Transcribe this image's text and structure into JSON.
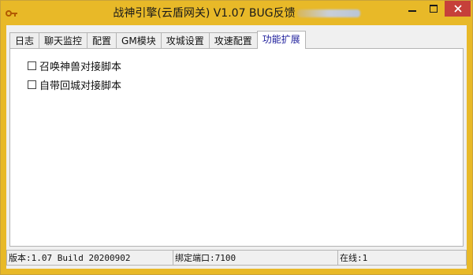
{
  "window": {
    "title": "战神引擎(云盾网关) V1.07 BUG反馈",
    "icon": "key-icon",
    "controls": {
      "minimize": "minimize-icon",
      "maximize": "maximize-icon",
      "close": "close-icon"
    }
  },
  "tabs": [
    {
      "label": "日志"
    },
    {
      "label": "聊天监控"
    },
    {
      "label": "配置"
    },
    {
      "label": "GM模块"
    },
    {
      "label": "攻城设置"
    },
    {
      "label": "攻速配置"
    },
    {
      "label": "功能扩展",
      "active": true
    }
  ],
  "options": [
    {
      "label": "召唤神兽对接脚本",
      "checked": false
    },
    {
      "label": "自带回城对接脚本",
      "checked": false
    }
  ],
  "status": {
    "version": "版本:1.07 Build 20200902",
    "port": "绑定端口:7100",
    "online": "在线:1"
  },
  "colors": {
    "title_bar": "#e8b928",
    "close_button": "#c6403a",
    "active_tab_text": "#1b1b9a"
  }
}
